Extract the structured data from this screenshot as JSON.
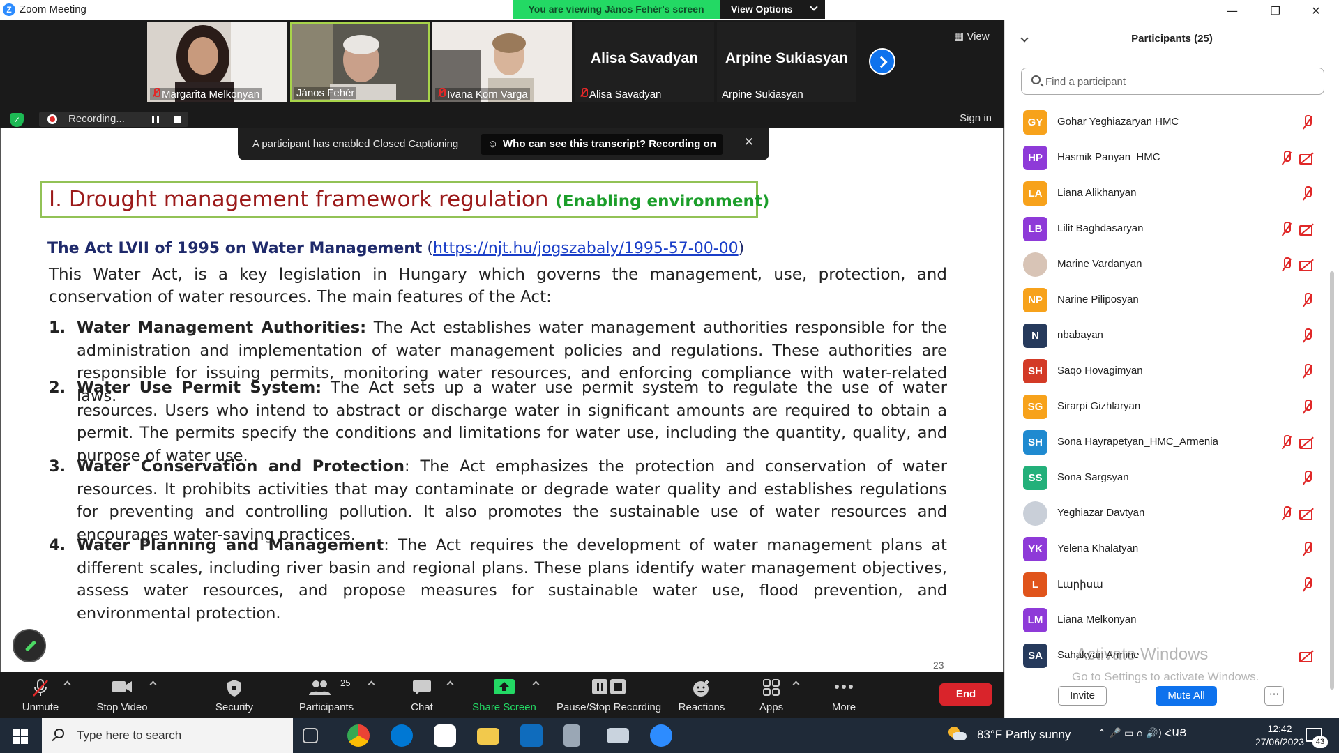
{
  "window": {
    "title": "Zoom Meeting",
    "logo_letter": "Z"
  },
  "share_banner": {
    "text": "You are viewing János Fehér's screen",
    "view_options": "View Options"
  },
  "window_controls": {
    "minimize": "—",
    "restore": "❐",
    "close": "✕"
  },
  "video_strip": {
    "tiles": [
      {
        "name": "Margarita Melkonyan",
        "muted": true,
        "video": true
      },
      {
        "name": "János Fehér",
        "muted": false,
        "video": true,
        "active": true
      },
      {
        "name": "Ivana Korn Varga",
        "muted": true,
        "video": true
      },
      {
        "name": "Alisa Savadyan",
        "big_name": "Alisa Savadyan",
        "muted": true,
        "video": false
      },
      {
        "name": "Arpine Sukiasyan",
        "big_name": "Arpine Sukiasyan",
        "muted": false,
        "video": false
      }
    ],
    "view_label": "View",
    "recording_label": "Recording...",
    "sign_in": "Sign in"
  },
  "caption_toast": {
    "message": "A participant has enabled Closed Captioning",
    "button": "Who can see this transcript? Recording on",
    "close": "✕"
  },
  "slide": {
    "title": "I. Drought management framework regulation",
    "title_sub": "(Enabling environment)",
    "act_title": "The Act LVII of 1995 on Water Management",
    "act_paren_open": "(",
    "act_link": "https://njt.hu/jogszabaly/1995-57-00-00",
    "act_paren_close": ")",
    "intro": "This Water Act, is a key legislation in Hungary which governs the management, use, protection, and conservation of water resources. The main features of the Act:",
    "points": [
      {
        "num": "1.",
        "head": "Water Management Authorities:",
        "text": " The Act establishes water management authorities responsible for the administration and implementation of water management policies and regulations. These authorities are responsible for issuing permits, monitoring water resources, and enforcing compliance with water-related laws."
      },
      {
        "num": "2.",
        "head": "Water Use Permit System:",
        "text": " The Act sets up a water use permit system to regulate the use of water resources. Users who intend to abstract or discharge water in significant amounts are required to obtain a permit. The permits specify the conditions and limitations for water use, including the quantity, quality, and purpose of water use."
      },
      {
        "num": "3.",
        "head": "Water Conservation and Protection",
        "text": ": The Act emphasizes the protection and conservation of water resources. It prohibits activities that may contaminate or degrade water quality and establishes regulations for preventing and controlling pollution. It also promotes the sustainable use of water resources and encourages water-saving practices."
      },
      {
        "num": "4.",
        "head": "Water Planning and Management",
        "text": ": The Act requires the development of water management plans at different scales, including river basin and regional plans. These plans identify water management objectives, assess water resources, and propose measures for sustainable water use, flood prevention, and environmental protection."
      }
    ],
    "page_number": "23"
  },
  "toolbar": {
    "unmute": "Unmute",
    "stop_video": "Stop Video",
    "security": "Security",
    "participants": "Participants",
    "participants_count": "25",
    "chat": "Chat",
    "share_screen": "Share Screen",
    "pause_stop_recording": "Pause/Stop Recording",
    "reactions": "Reactions",
    "apps": "Apps",
    "more": "More",
    "end": "End"
  },
  "participants_panel": {
    "title": "Participants (25)",
    "search_placeholder": "Find a participant",
    "rows": [
      {
        "initials": "GY",
        "name": "Gohar Yeghiazaryan HMC",
        "color": "#f7a21b",
        "video_off": false
      },
      {
        "initials": "HP",
        "name": "Hasmik Panyan_HMC",
        "color": "#8e3ad8",
        "video_off": true
      },
      {
        "initials": "LA",
        "name": "Liana Alikhanyan",
        "color": "#f7a21b",
        "video_off": false
      },
      {
        "initials": "LB",
        "name": "Lilit Baghdasaryan",
        "color": "#8e3ad8",
        "video_off": true
      },
      {
        "initials": "",
        "name": "Marine Vardanyan",
        "color": "#d8c4b6",
        "video_off": true,
        "photo": true
      },
      {
        "initials": "NP",
        "name": "Narine Piliposyan",
        "color": "#f7a21b",
        "video_off": false
      },
      {
        "initials": "N",
        "name": "nbabayan",
        "color": "#263a5c",
        "video_off": false
      },
      {
        "initials": "SH",
        "name": "Saqo Hovagimyan",
        "color": "#d33a26",
        "video_off": false
      },
      {
        "initials": "SG",
        "name": "Sirarpi Gizhlaryan",
        "color": "#f7a21b",
        "video_off": false
      },
      {
        "initials": "SH",
        "name": "Sona Hayrapetyan_HMC_Armenia",
        "color": "#1f8ad0",
        "video_off": true
      },
      {
        "initials": "SS",
        "name": "Sona Sargsyan",
        "color": "#23b07a",
        "video_off": false
      },
      {
        "initials": "",
        "name": "Yeghiazar Davtyan",
        "color": "#c9cfd8",
        "video_off": true,
        "photo": true
      },
      {
        "initials": "YK",
        "name": "Yelena Khalatyan",
        "color": "#8e3ad8",
        "video_off": false
      },
      {
        "initials": "L",
        "name": "Լարիսա",
        "color": "#e0541b",
        "video_off": false
      },
      {
        "initials": "LM",
        "name": "Liana Melkonyan",
        "color": "#8e3ad8",
        "video_off": false,
        "no_icons": true
      },
      {
        "initials": "SA",
        "name": "Sahakyan Armine",
        "color": "#263a5c",
        "video_off": true,
        "video_only": true
      }
    ],
    "invite": "Invite",
    "mute_all": "Mute All",
    "more": "···"
  },
  "watermark": {
    "line1": "Activate Windows",
    "line2": "Go to Settings to activate Windows."
  },
  "taskbar": {
    "search_placeholder": "Type here to search",
    "weather": "83°F  Partly sunny",
    "tray": "⌃  🎤  ▭  ⌂  🔊)  ՀԱՅ",
    "time": "12:42",
    "date": "27/06/2023",
    "notification_count": "43"
  },
  "colors": {
    "share_green": "#23d964",
    "zoom_blue": "#0e72ed",
    "end_red": "#d9242b",
    "title_red": "#9b1a1a",
    "subtitle_green": "#1b9e2a",
    "frame_green": "#92c256",
    "act_navy": "#1f2a6b"
  }
}
